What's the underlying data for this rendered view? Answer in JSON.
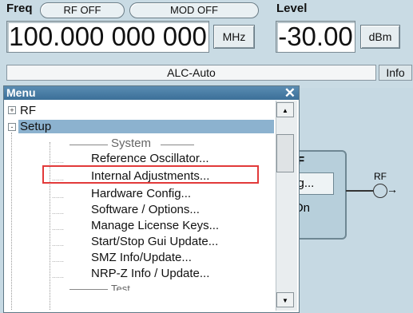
{
  "header": {
    "freq_label": "Freq",
    "rf_off": "RF OFF",
    "mod_off": "MOD OFF",
    "freq_value": "100.000 000 000",
    "freq_unit": "MHz",
    "level_label": "Level",
    "level_value": "-30.00",
    "level_unit": "dBm",
    "alc": "ALC-Auto",
    "info": "Info"
  },
  "diagram": {
    "block_title": "F",
    "config_label": "fig...",
    "on_label": "On",
    "rf_label": "RF"
  },
  "menu": {
    "title": "Menu",
    "nodes": [
      {
        "label": "RF",
        "expander": "+"
      },
      {
        "label": "Setup",
        "expander": "-"
      }
    ],
    "section_system": "System",
    "items": [
      "Reference Oscillator...",
      "Internal Adjustments...",
      "Hardware Config...",
      "Software / Options...",
      "Manage License Keys...",
      "Start/Stop Gui Update...",
      "SMZ Info/Update...",
      "NRP-Z Info / Update..."
    ],
    "section_test_partial": "Test",
    "highlighted_item": "Internal Adjustments..."
  },
  "colors": {
    "background": "#c6d9e3",
    "menu_title": "#3b6f98",
    "selection": "#8cb2cf",
    "highlight_box": "#e23a3a"
  }
}
